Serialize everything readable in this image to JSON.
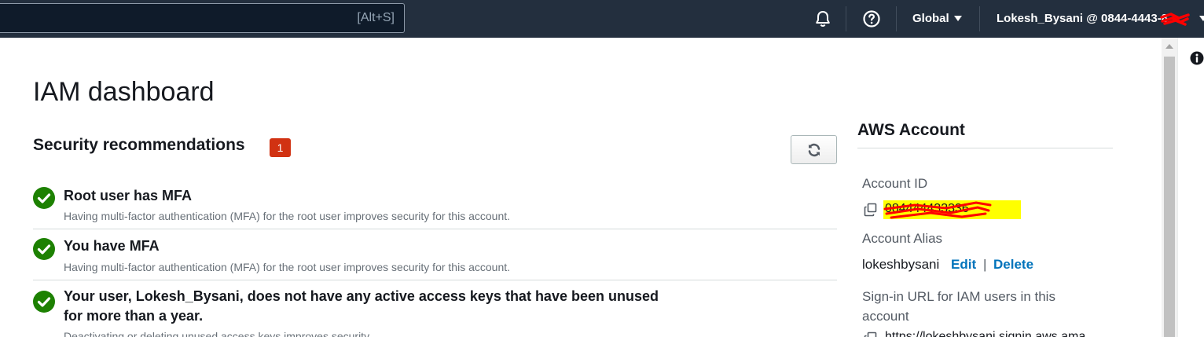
{
  "topbar": {
    "search_shortcut": "[Alt+S]",
    "region_label": "Global",
    "account_label": "Lokesh_Bysani @ 0844-4443-8",
    "icons": [
      "bell-icon",
      "help-icon"
    ]
  },
  "main": {
    "page_title": "IAM dashboard",
    "security": {
      "title": "Security recommendations",
      "badge_count": "1",
      "items": [
        {
          "title": "Root user has MFA",
          "description": "Having multi-factor authentication (MFA) for the root user improves security for this account."
        },
        {
          "title": "You have MFA",
          "description": "Having multi-factor authentication (MFA) for the root user improves security for this account."
        },
        {
          "title": "Your user, Lokesh_Bysani, does not have any active access keys that have been unused for more than a year.",
          "description": "Deactivating or deleting unused access keys improves security."
        }
      ]
    }
  },
  "aws_account": {
    "title": "AWS Account",
    "account_id_label": "Account ID",
    "account_id_value": "084444433336",
    "account_alias_label": "Account Alias",
    "account_alias_value": "lokeshbysani",
    "edit_label": "Edit",
    "separator": "|",
    "delete_label": "Delete",
    "signin_label": "Sign-in URL for IAM users in this account",
    "signin_url": "https://lokeshbysani.signin.aws.ama"
  },
  "colors": {
    "topbar": "#232f3e",
    "badge": "#d13212",
    "success": "#1d8102",
    "link": "#0073bb",
    "highlight": "#ffff00",
    "redaction": "#ff0000"
  }
}
